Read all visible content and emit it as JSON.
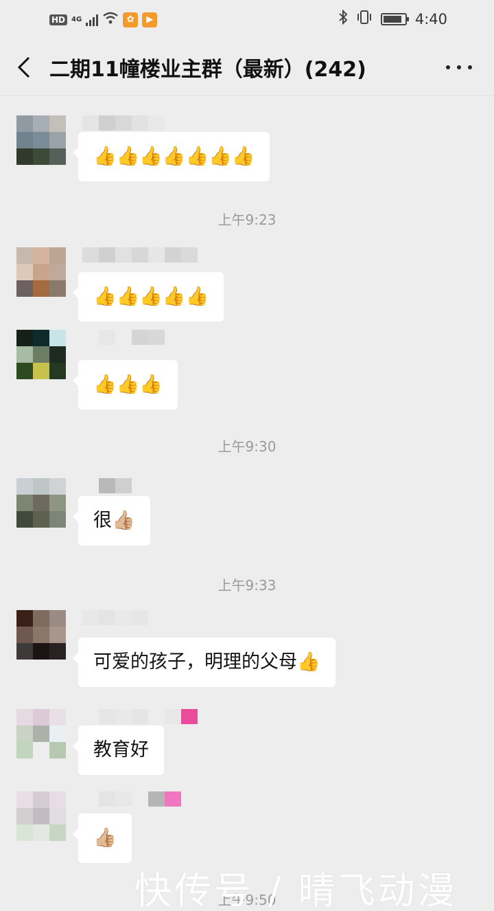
{
  "status_bar": {
    "hd": "HD",
    "network": "4G",
    "time": "4:40",
    "battery_level": 0.85,
    "icons": [
      "hd-icon",
      "signal-icon",
      "wifi-icon",
      "app-notification-icon",
      "video-app-icon",
      "bluetooth-icon",
      "vibrate-icon",
      "battery-icon"
    ]
  },
  "header": {
    "title": "二期11幢楼业主群（最新）(242)",
    "back_icon": "chevron-left-icon",
    "more_icon": "more-dots-icon"
  },
  "messages": [
    {
      "id": "m1",
      "text": "👍👍👍👍👍👍👍",
      "avatar_colors": [
        "#8f9aa3",
        "#a7aeb4",
        "#c2c0b8",
        "#6f828e",
        "#7a8c98",
        "#9aa4a8",
        "#2f3a2b",
        "#3e4a38",
        "#56605a"
      ]
    },
    {
      "id": "m2",
      "text": "👍👍👍👍👍",
      "avatar_colors": [
        "#c9b8ac",
        "#d4b49d",
        "#bda594",
        "#ddc9b9",
        "#c8a48b",
        "#c0a99a",
        "#6c6060",
        "#a46a40",
        "#8a7a6e"
      ]
    },
    {
      "id": "m3",
      "text": "👍👍👍",
      "avatar_colors": [
        "#152018",
        "#0f2a2c",
        "#c8e4e8",
        "#a7bca5",
        "#6c7d66",
        "#1f2b21",
        "#2e4a23",
        "#c7c24d",
        "#243822"
      ]
    },
    {
      "id": "m4",
      "text": "很👍🏼",
      "avatar_colors": [
        "#c9cfd4",
        "#bfc6c8",
        "#cfd3d6",
        "#7c8671",
        "#6e6a60",
        "#8c9682",
        "#3f4a3d",
        "#5e6150",
        "#7d8478"
      ]
    },
    {
      "id": "m5",
      "text": "可爱的孩子，明理的父母👍",
      "avatar_colors": [
        "#3a2018",
        "#806a60",
        "#9a8c84",
        "#6e5850",
        "#8b766c",
        "#a8968c",
        "#3e3a3a",
        "#1c1414",
        "#2a2222"
      ]
    },
    {
      "id": "m6",
      "text": "教育好",
      "avatar_colors": [
        "#e6d9e2",
        "#dccbd6",
        "#e9e0e5",
        "#c9d2c4",
        "#aeb0aa",
        "#e8f0f2",
        "#c1d5bc",
        "#ededed",
        "#b7c8b0"
      ]
    },
    {
      "id": "m7",
      "text": "👍🏼",
      "avatar_colors": [
        "#eadde6",
        "#d5ccd2",
        "#e8dce6",
        "#d3cfd1",
        "#c2bcc0",
        "#e0dde0",
        "#d9e5d6",
        "#e3e8e2",
        "#c6d6c2"
      ]
    }
  ],
  "timestamps": [
    "上午9:23",
    "上午9:30",
    "上午9:33",
    "上午9:50"
  ],
  "watermark": "快传号 / 晴飞动漫"
}
